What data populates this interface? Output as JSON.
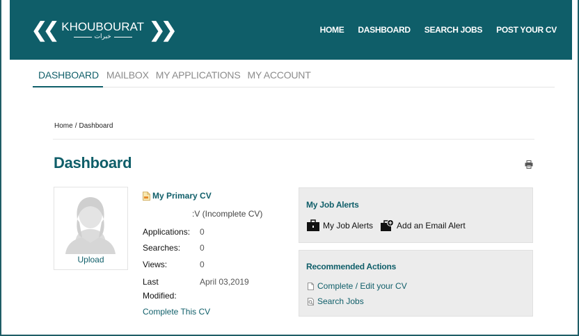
{
  "brand": {
    "name_en": "KHOUBOURAT",
    "name_ar": "خبرات"
  },
  "topnav": {
    "items": [
      "HOME",
      "DASHBOARD",
      "SEARCH JOBS",
      "POST YOUR CV"
    ]
  },
  "tabs": {
    "items": [
      "DASHBOARD",
      "MAILBOX",
      "MY APPLICATIONS",
      "MY ACCOUNT"
    ],
    "active": "DASHBOARD"
  },
  "breadcrumb": {
    "home": "Home",
    "separator": "/",
    "current": "Dashboard"
  },
  "page": {
    "title": "Dashboard"
  },
  "profile": {
    "upload_label": "Upload"
  },
  "cv": {
    "title": "My Primary CV",
    "status": ":V (Incomplete CV)",
    "applications_label": "Applications:",
    "applications_value": "0",
    "searches_label": "Searches:",
    "searches_value": "0",
    "views_label": "Views:",
    "views_value": "0",
    "last_label": "Last",
    "modified_label": "Modified:",
    "last_modified_value": "April 03,2019",
    "complete_link": "Complete This CV"
  },
  "job_alerts": {
    "title": "My Job Alerts",
    "my_alerts_label": "My Job Alerts",
    "add_alert_label": "Add an Email Alert"
  },
  "recommended": {
    "title": "Recommended Actions",
    "items": [
      "Complete / Edit your CV",
      "Search Jobs"
    ]
  },
  "colors": {
    "brand_teal": "#0f5e69",
    "panel_bg": "#ececec"
  }
}
